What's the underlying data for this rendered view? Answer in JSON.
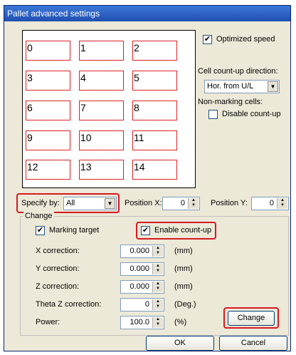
{
  "window": {
    "title": "Pallet advanced settings"
  },
  "grid": {
    "cells": [
      "0",
      "1",
      "2",
      "3",
      "4",
      "5",
      "6",
      "7",
      "8",
      "9",
      "10",
      "11",
      "12",
      "13",
      "14"
    ]
  },
  "options": {
    "optimized_speed_label": "Optimized speed",
    "optimized_speed_checked": true,
    "count_up_direction_label": "Cell count-up direction:",
    "count_up_direction_value": "Hor. from U/L",
    "non_marking_label": "Non-marking cells:",
    "disable_count_up_label": "Disable count-up",
    "disable_count_up_checked": false
  },
  "specify": {
    "label": "Specify by:",
    "value": "All",
    "position_x_label": "Position X:",
    "position_x_value": "0",
    "position_y_label": "Position Y:",
    "position_y_value": "0"
  },
  "change_group": {
    "legend": "Change",
    "marking_target_label": "Marking target",
    "marking_target_checked": true,
    "enable_count_up_label": "Enable count-up",
    "enable_count_up_checked": true,
    "rows": [
      {
        "label": "X correction:",
        "value": "0.000",
        "unit": "(mm)"
      },
      {
        "label": "Y correction:",
        "value": "0.000",
        "unit": "(mm)"
      },
      {
        "label": "Z correction:",
        "value": "0.000",
        "unit": "(mm)"
      },
      {
        "label": "Theta Z correction:",
        "value": "0",
        "unit": "(Deg.)"
      },
      {
        "label": "Power:",
        "value": "100.0",
        "unit": "(%)"
      }
    ],
    "change_button": "Change"
  },
  "footer": {
    "ok": "OK",
    "cancel": "Cancel"
  },
  "colors": {
    "highlight": "#d71920",
    "title_bar": "#2f63c6",
    "dialog_bg": "#ece9d8"
  }
}
